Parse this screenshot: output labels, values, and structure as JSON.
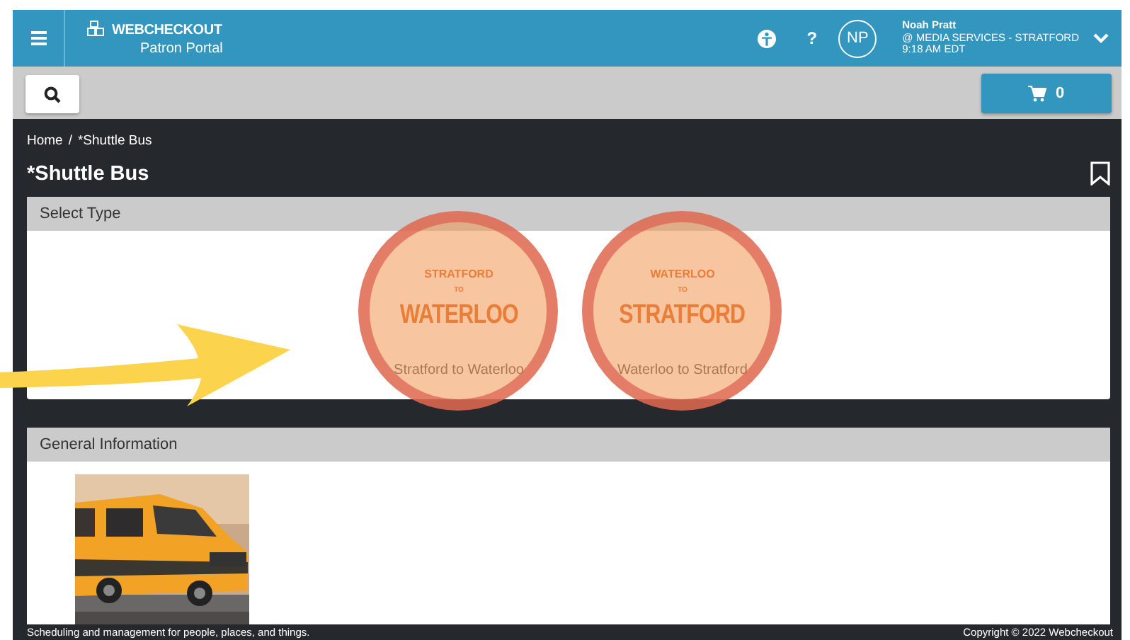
{
  "header": {
    "logo": "WEBCHECKOUT",
    "subtitle": "Patron Portal",
    "help": "?",
    "avatar": "NP",
    "user_name": "Noah Pratt",
    "user_location": "@ MEDIA SERVICES - STRATFORD",
    "user_time": "9:18 AM EDT"
  },
  "toolbar": {
    "cart_count": "0"
  },
  "breadcrumb": [
    {
      "label": "Home"
    },
    {
      "label": "*Shuttle Bus"
    }
  ],
  "breadcrumb_separator": "/",
  "title": "*Shuttle Bus",
  "select_type": {
    "heading": "Select Type",
    "options": [
      {
        "from": "STRATFORD",
        "to_word": "TO",
        "destination": "WATERLOO",
        "label": "Stratford to Waterloo",
        "highlighted": true
      },
      {
        "from": "WATERLOO",
        "to_word": "TO",
        "destination": "STRATFORD",
        "label": "Waterloo to Stratford",
        "highlighted": true
      }
    ]
  },
  "general_information": {
    "heading": "General Information"
  },
  "footer": {
    "tagline": "Scheduling and management for people, places, and things.",
    "copyright": "Copyright © 2022 Webcheckout"
  }
}
